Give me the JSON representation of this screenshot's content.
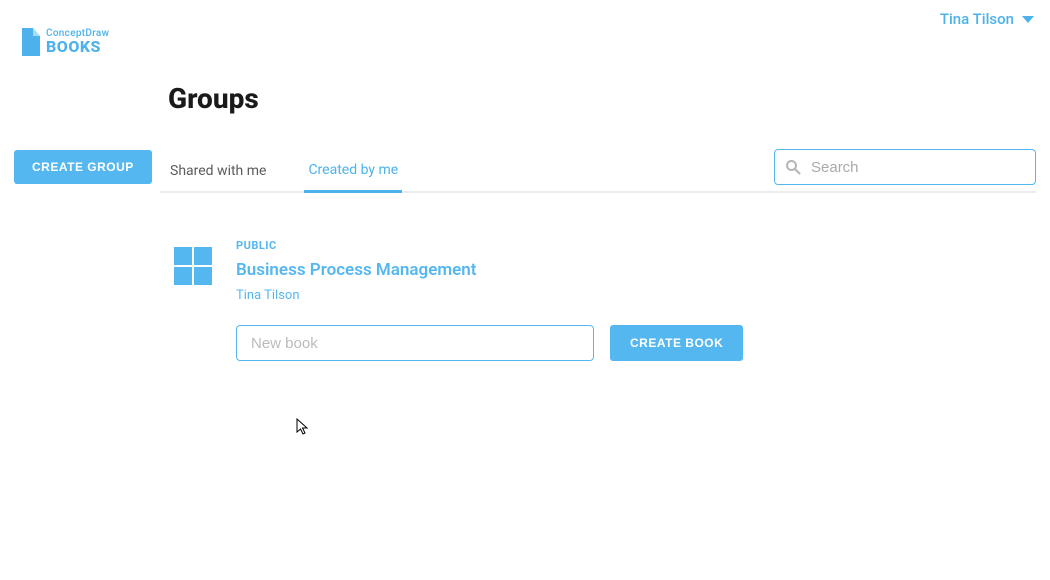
{
  "header": {
    "user_name": "Tina Tilson"
  },
  "logo": {
    "top": "ConceptDraw",
    "bottom": "BOOKS"
  },
  "sidebar": {
    "create_group_label": "CREATE GROUP"
  },
  "main": {
    "title": "Groups",
    "tabs": [
      {
        "label": "Shared with me",
        "active": false
      },
      {
        "label": "Created by me",
        "active": true
      }
    ],
    "search": {
      "placeholder": "Search",
      "value": ""
    },
    "group": {
      "visibility": "PUBLIC",
      "name": "Business Process Management",
      "owner": "Tina Tilson",
      "new_book_placeholder": "New book",
      "new_book_value": "",
      "create_book_label": "CREATE BOOK"
    }
  },
  "colors": {
    "accent": "#55B7F0",
    "link": "#4DB2EC"
  }
}
